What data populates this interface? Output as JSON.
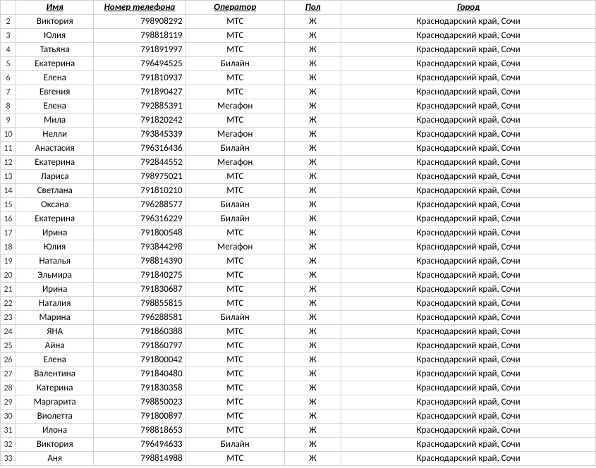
{
  "headers": {
    "name": "Имя",
    "phone": "Номер телефона",
    "operator": "Оператор",
    "sex": "Пол",
    "city": "Город"
  },
  "rows": [
    {
      "num": "2",
      "name": "Виктория",
      "phone": "798908292",
      "op": "МТС",
      "sex": "Ж",
      "city": "Краснодарский край, Сочи"
    },
    {
      "num": "3",
      "name": "Юлия",
      "phone": "798818119",
      "op": "МТС",
      "sex": "Ж",
      "city": "Краснодарский край, Сочи"
    },
    {
      "num": "4",
      "name": "Татьяна",
      "phone": "791891997",
      "op": "МТС",
      "sex": "Ж",
      "city": "Краснодарский край, Сочи"
    },
    {
      "num": "5",
      "name": "Екатерина",
      "phone": "796494525",
      "op": "Билайн",
      "sex": "Ж",
      "city": "Краснодарский край, Сочи"
    },
    {
      "num": "6",
      "name": "Елена",
      "phone": "791810937",
      "op": "МТС",
      "sex": "Ж",
      "city": "Краснодарский край, Сочи"
    },
    {
      "num": "7",
      "name": "Евгения",
      "phone": "791890427",
      "op": "МТС",
      "sex": "Ж",
      "city": "Краснодарский край, Сочи"
    },
    {
      "num": "8",
      "name": "Елена",
      "phone": "792885391",
      "op": "Мегафон",
      "sex": "Ж",
      "city": "Краснодарский край, Сочи"
    },
    {
      "num": "9",
      "name": "Мила",
      "phone": "791820242",
      "op": "МТС",
      "sex": "Ж",
      "city": "Краснодарский край, Сочи"
    },
    {
      "num": "10",
      "name": "Нелли",
      "phone": "793845339",
      "op": "Мегафон",
      "sex": "Ж",
      "city": "Краснодарский край, Сочи"
    },
    {
      "num": "11",
      "name": "Анастасия",
      "phone": "796316436",
      "op": "Билайн",
      "sex": "Ж",
      "city": "Краснодарский край, Сочи"
    },
    {
      "num": "12",
      "name": "Екатерина",
      "phone": "792844552",
      "op": "Мегафон",
      "sex": "Ж",
      "city": "Краснодарский край, Сочи"
    },
    {
      "num": "13",
      "name": "Лариса",
      "phone": "798975021",
      "op": "МТС",
      "sex": "Ж",
      "city": "Краснодарский край, Сочи"
    },
    {
      "num": "14",
      "name": "Светлана",
      "phone": "791810210",
      "op": "МТС",
      "sex": "Ж",
      "city": "Краснодарский край, Сочи"
    },
    {
      "num": "15",
      "name": "Оксана",
      "phone": "796288577",
      "op": "Билайн",
      "sex": "Ж",
      "city": "Краснодарский край, Сочи"
    },
    {
      "num": "16",
      "name": "Екатерина",
      "phone": "796316229",
      "op": "Билайн",
      "sex": "Ж",
      "city": "Краснодарский край, Сочи"
    },
    {
      "num": "17",
      "name": "Ирина",
      "phone": "791800548",
      "op": "МТС",
      "sex": "Ж",
      "city": "Краснодарский край, Сочи"
    },
    {
      "num": "18",
      "name": "Юлия",
      "phone": "793844298",
      "op": "Мегафон",
      "sex": "Ж",
      "city": "Краснодарский край, Сочи"
    },
    {
      "num": "19",
      "name": "Наталья",
      "phone": "798814390",
      "op": "МТС",
      "sex": "Ж",
      "city": "Краснодарский край, Сочи"
    },
    {
      "num": "20",
      "name": "Эльмира",
      "phone": "791840275",
      "op": "МТС",
      "sex": "Ж",
      "city": "Краснодарский край, Сочи"
    },
    {
      "num": "21",
      "name": "Ирина",
      "phone": "791830687",
      "op": "МТС",
      "sex": "Ж",
      "city": "Краснодарский край, Сочи"
    },
    {
      "num": "22",
      "name": "Наталия",
      "phone": "798855815",
      "op": "МТС",
      "sex": "Ж",
      "city": "Краснодарский край, Сочи"
    },
    {
      "num": "23",
      "name": "Марина",
      "phone": "796288581",
      "op": "Билайн",
      "sex": "Ж",
      "city": "Краснодарский край, Сочи"
    },
    {
      "num": "24",
      "name": "ЯНА",
      "phone": "791860388",
      "op": "МТС",
      "sex": "Ж",
      "city": "Краснодарский край, Сочи"
    },
    {
      "num": "25",
      "name": "Айна",
      "phone": "791860797",
      "op": "МТС",
      "sex": "Ж",
      "city": "Краснодарский край, Сочи"
    },
    {
      "num": "26",
      "name": "Елена",
      "phone": "791800042",
      "op": "МТС",
      "sex": "Ж",
      "city": "Краснодарский край, Сочи"
    },
    {
      "num": "27",
      "name": "Валентина",
      "phone": "791840480",
      "op": "МТС",
      "sex": "Ж",
      "city": "Краснодарский край, Сочи"
    },
    {
      "num": "28",
      "name": "Катерина",
      "phone": "791830358",
      "op": "МТС",
      "sex": "Ж",
      "city": "Краснодарский край, Сочи"
    },
    {
      "num": "29",
      "name": "Маргарита",
      "phone": "798850023",
      "op": "МТС",
      "sex": "Ж",
      "city": "Краснодарский край, Сочи"
    },
    {
      "num": "30",
      "name": "Виолетта",
      "phone": "791800897",
      "op": "МТС",
      "sex": "Ж",
      "city": "Краснодарский край, Сочи"
    },
    {
      "num": "31",
      "name": "Илона",
      "phone": "798818653",
      "op": "МТС",
      "sex": "Ж",
      "city": "Краснодарский край, Сочи"
    },
    {
      "num": "32",
      "name": "Виктория",
      "phone": "796494633",
      "op": "Билайн",
      "sex": "Ж",
      "city": "Краснодарский край, Сочи"
    },
    {
      "num": "33",
      "name": "Аня",
      "phone": "798814988",
      "op": "МТС",
      "sex": "Ж",
      "city": "Краснодарский край, Сочи"
    }
  ]
}
